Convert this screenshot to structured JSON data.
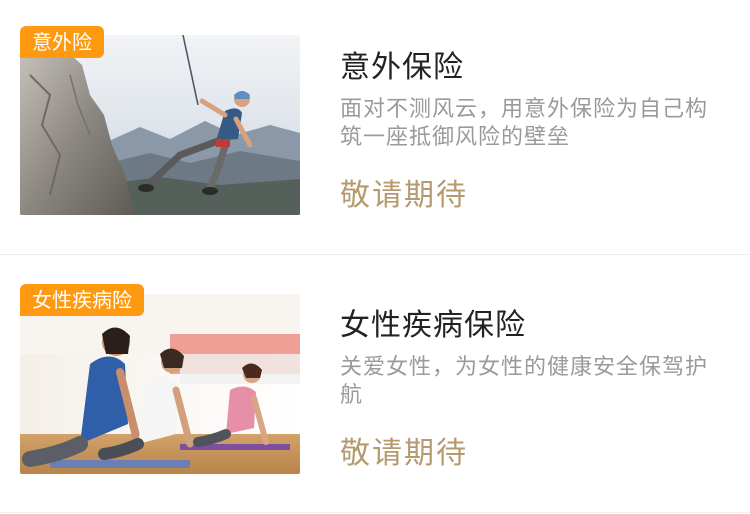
{
  "products": [
    {
      "badge": "意外险",
      "title": "意外保险",
      "description": "面对不测风云，用意外保险为自己构筑一座抵御风险的壁垒",
      "cta": "敬请期待",
      "image": "rock-climber-photo"
    },
    {
      "badge": "女性疾病险",
      "title": "女性疾病保险",
      "description": "关爱女性，为女性的健康安全保驾护航",
      "cta": "敬请期待",
      "image": "yoga-class-photo"
    }
  ],
  "colors": {
    "badge": "#ff9a10",
    "title": "#222222",
    "description": "#9a9a9a",
    "cta": "#b59a70",
    "divider": "#eeeeee"
  }
}
